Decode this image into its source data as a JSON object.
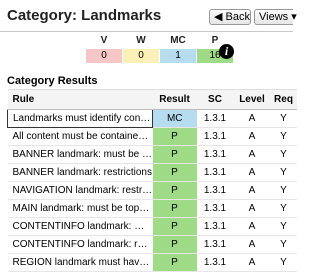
{
  "header": {
    "title": "Category: Landmarks",
    "back_label": "◀ Back",
    "views_label": "Views ▾"
  },
  "summary": {
    "items": [
      {
        "label": "V",
        "value": "0",
        "color": "#f7c6c6"
      },
      {
        "label": "W",
        "value": "0",
        "color": "#fbf0b8"
      },
      {
        "label": "MC",
        "value": "1",
        "color": "#b6dcef"
      },
      {
        "label": "P",
        "value": "16",
        "color": "#9fdb86"
      }
    ],
    "info_icon": "info-icon",
    "info_glyph": "i"
  },
  "results": {
    "section_title": "Category Results",
    "columns": [
      "Rule",
      "Result",
      "SC",
      "Level",
      "Req"
    ],
    "result_colors": {
      "MC": "#b6dcef",
      "P": "#9fdb86"
    },
    "rows": [
      {
        "rule": "Landmarks must identify conten...",
        "result": "MC",
        "sc": "1.3.1",
        "level": "A",
        "req": "Y"
      },
      {
        "rule": "All content must be contained in...",
        "result": "P",
        "sc": "1.3.1",
        "level": "A",
        "req": "Y"
      },
      {
        "rule": "BANNER landmark: must be top-...",
        "result": "P",
        "sc": "1.3.1",
        "level": "A",
        "req": "Y"
      },
      {
        "rule": "BANNER landmark: restrictions",
        "result": "P",
        "sc": "1.3.1",
        "level": "A",
        "req": "Y"
      },
      {
        "rule": "NAVIGATION landmark: restricti...",
        "result": "P",
        "sc": "1.3.1",
        "level": "A",
        "req": "Y"
      },
      {
        "rule": "MAIN landmark: must be top-le...",
        "result": "P",
        "sc": "1.3.1",
        "level": "A",
        "req": "Y"
      },
      {
        "rule": "CONTENTINFO landmark: must ...",
        "result": "P",
        "sc": "1.3.1",
        "level": "A",
        "req": "Y"
      },
      {
        "rule": "CONTENTINFO landmark: restri...",
        "result": "P",
        "sc": "1.3.1",
        "level": "A",
        "req": "Y"
      },
      {
        "rule": "REGION landmark must have ac...",
        "result": "P",
        "sc": "1.3.1",
        "level": "A",
        "req": "Y"
      }
    ]
  }
}
